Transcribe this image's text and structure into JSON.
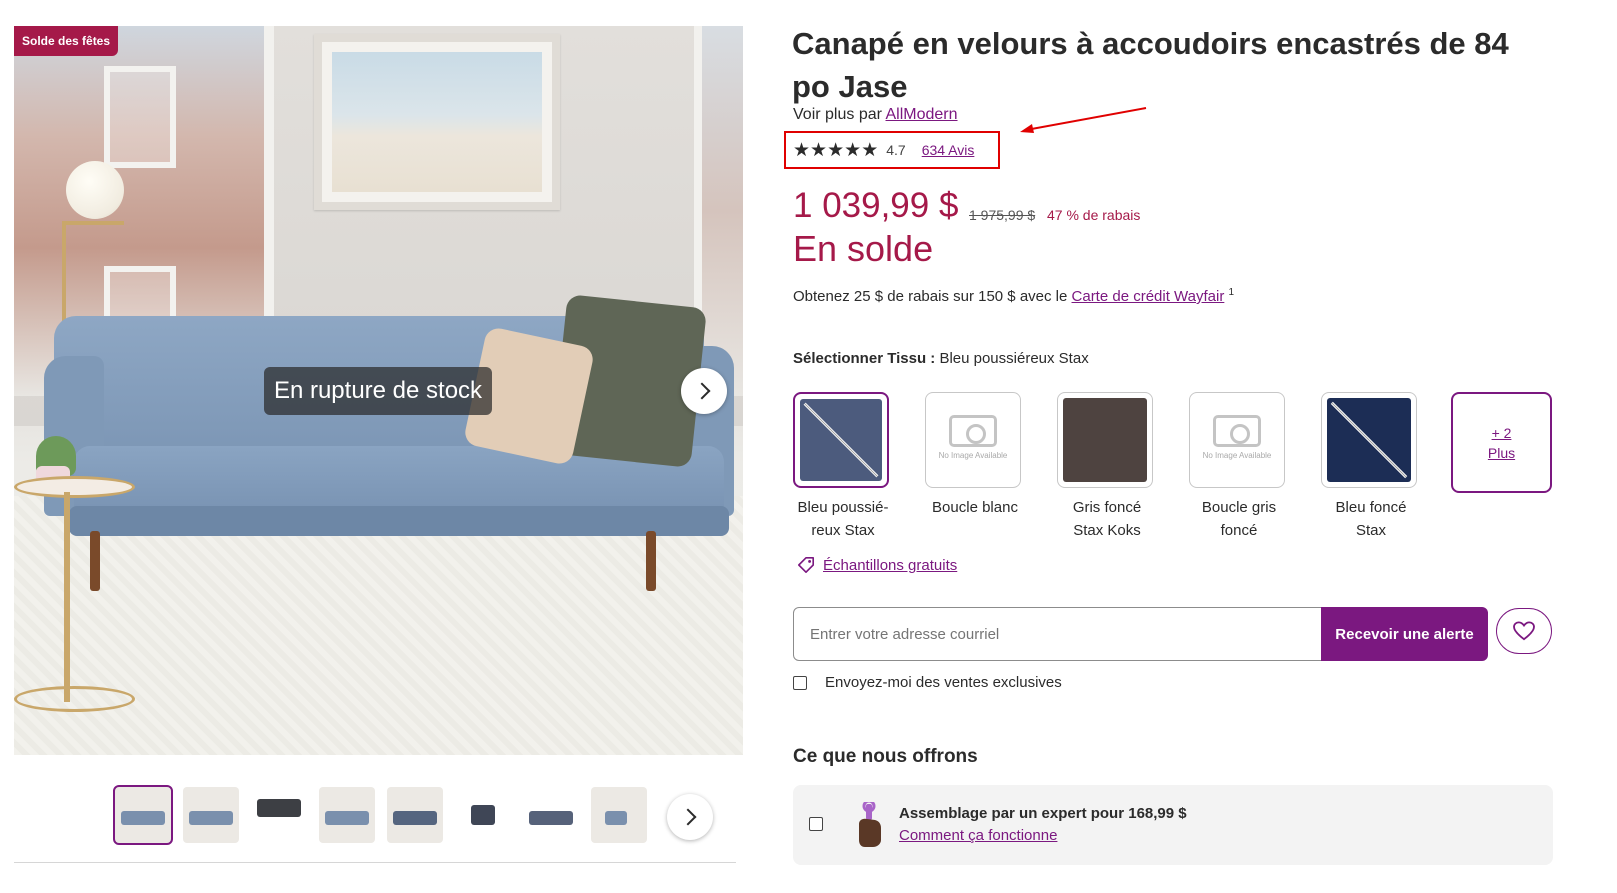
{
  "gallery": {
    "badge": "Solde des fêtes",
    "stock_overlay": "En rupture de stock",
    "thumbnail_count": 8
  },
  "product": {
    "title": "Canapé en velours à accoudoirs encastrés de 84 po Jase",
    "byline_prefix": "Voir plus par ",
    "brand": "AllModern",
    "rating": {
      "stars": 5,
      "value": "4.7",
      "reviews_label": "634 Avis"
    },
    "price": {
      "current": "1 039,99 $",
      "original": "1 975,99 $",
      "discount": "47 % de rabais",
      "sale_label": "En solde"
    },
    "credit": {
      "prefix": "Obtenez 25 $ de rabais sur 150 $ avec le ",
      "link": "Carte de crédit Wayfair",
      "footnote": "1"
    }
  },
  "fabric": {
    "label": "Sélectionner Tissu :",
    "selected": "Bleu poussiéreux Stax",
    "swatches": [
      {
        "label": "Bleu poussié-reux Stax",
        "color": "#4c5b7d",
        "image": true,
        "selected": true
      },
      {
        "label": "Boucle blanc",
        "image": false,
        "no_image_text": "No Image Available"
      },
      {
        "label": "Gris foncé Stax Koks",
        "color": "#4e4340",
        "image": true
      },
      {
        "label": "Boucle gris foncé",
        "image": false,
        "no_image_text": "No Image Available"
      },
      {
        "label": "Bleu foncé Stax",
        "color": "#1c2d55",
        "image": true
      }
    ],
    "more": {
      "count": "+ 2",
      "label": "Plus"
    },
    "samples_link": "Échantillons gratuits"
  },
  "alert": {
    "email_placeholder": "Entrer votre adresse courriel",
    "button": "Recevoir une alerte",
    "exclusive_label": "Envoyez-moi des ventes exclusives"
  },
  "offers": {
    "heading": "Ce que nous offrons",
    "assembly_title": "Assemblage par un expert pour 168,99 $",
    "assembly_link": "Comment ça fonctionne"
  },
  "colors": {
    "brand_purple": "#7b1880",
    "sale_red": "#a51949",
    "highlight_red": "#e00000"
  },
  "icons": [
    "chevron-right-icon",
    "star-icon",
    "tag-icon",
    "heart-icon",
    "wrench-hand-icon",
    "camera-placeholder-icon"
  ]
}
